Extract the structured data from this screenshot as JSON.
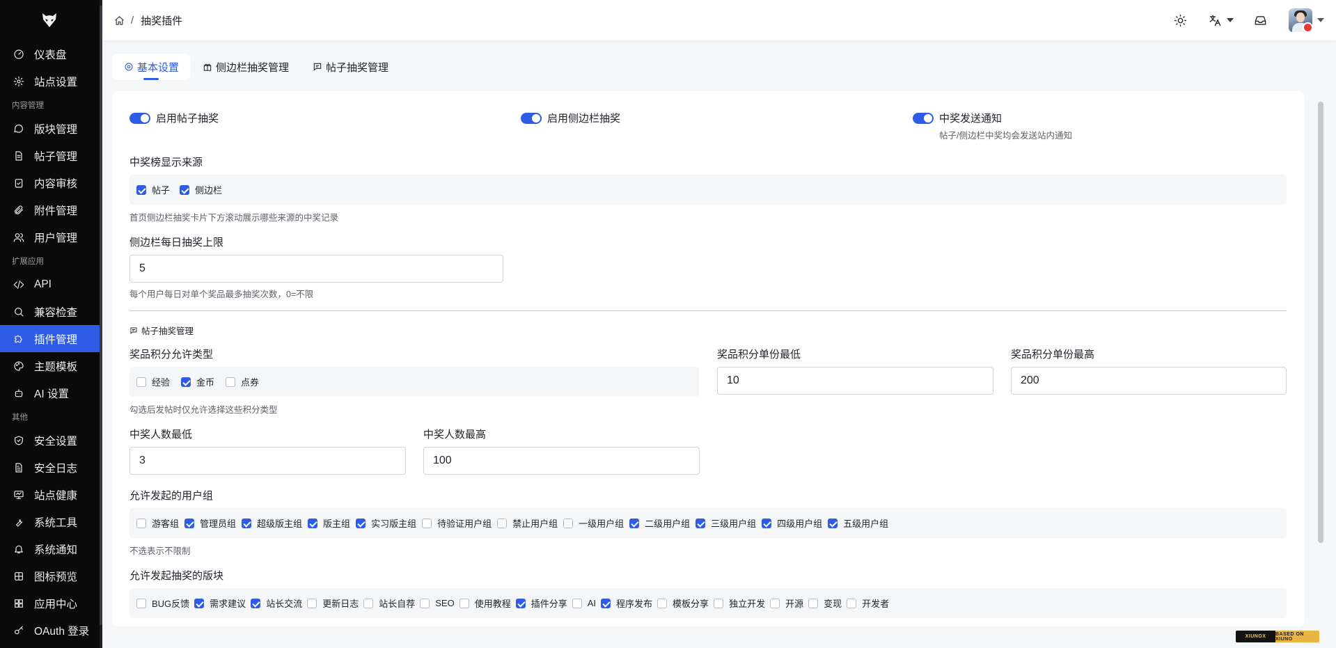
{
  "sidebar": {
    "items": [
      {
        "type": "item",
        "label": "仪表盘",
        "icon": "dashboard-icon"
      },
      {
        "type": "item",
        "label": "站点设置",
        "icon": "gear-icon"
      },
      {
        "type": "section",
        "label": "内容管理"
      },
      {
        "type": "item",
        "label": "版块管理",
        "icon": "chat-bubble-icon"
      },
      {
        "type": "item",
        "label": "帖子管理",
        "icon": "document-icon"
      },
      {
        "type": "item",
        "label": "内容审核",
        "icon": "clipboard-check-icon"
      },
      {
        "type": "item",
        "label": "附件管理",
        "icon": "paperclip-icon"
      },
      {
        "type": "item",
        "label": "用户管理",
        "icon": "users-icon"
      },
      {
        "type": "section",
        "label": "扩展应用"
      },
      {
        "type": "item",
        "label": "API",
        "icon": "code-icon"
      },
      {
        "type": "item",
        "label": "兼容检查",
        "icon": "search-icon"
      },
      {
        "type": "item",
        "label": "插件管理",
        "icon": "puzzle-icon",
        "active": true
      },
      {
        "type": "item",
        "label": "主题模板",
        "icon": "palette-icon"
      },
      {
        "type": "item",
        "label": "AI 设置",
        "icon": "robot-icon"
      },
      {
        "type": "section",
        "label": "其他"
      },
      {
        "type": "item",
        "label": "安全设置",
        "icon": "shield-icon"
      },
      {
        "type": "item",
        "label": "安全日志",
        "icon": "log-icon"
      },
      {
        "type": "item",
        "label": "站点健康",
        "icon": "monitor-icon"
      },
      {
        "type": "item",
        "label": "系统工具",
        "icon": "wrench-icon"
      },
      {
        "type": "item",
        "label": "系统通知",
        "icon": "bell-icon"
      },
      {
        "type": "item",
        "label": "图标预览",
        "icon": "grid-icon"
      },
      {
        "type": "item",
        "label": "应用中心",
        "icon": "apps-icon"
      },
      {
        "type": "item",
        "label": "OAuth 登录",
        "icon": "key-icon"
      }
    ]
  },
  "header": {
    "breadcrumb_sep": "/",
    "breadcrumb_current": "抽奖插件",
    "icons": [
      "home-icon",
      "sun-icon",
      "translate-icon",
      "inbox-icon",
      "avatar"
    ]
  },
  "tabs": [
    {
      "label": "基本设置",
      "icon": "gear-icon",
      "active": true
    },
    {
      "label": "侧边栏抽奖管理",
      "icon": "gift-icon"
    },
    {
      "label": "帖子抽奖管理",
      "icon": "chat-square-icon"
    }
  ],
  "form": {
    "toggles": [
      {
        "label": "启用帖子抽奖",
        "on": true
      },
      {
        "label": "启用侧边栏抽奖",
        "on": true
      },
      {
        "label": "中奖发送通知",
        "on": true,
        "hint": "帖子/侧边栏中奖均会发送站内通知"
      }
    ],
    "winners_source": {
      "label": "中奖榜显示来源",
      "options": [
        {
          "label": "帖子",
          "checked": true
        },
        {
          "label": "侧边栏",
          "checked": true
        }
      ],
      "hint": "首页侧边栏抽奖卡片下方滚动展示哪些来源的中奖记录"
    },
    "sidebar_daily_limit": {
      "label": "侧边栏每日抽奖上限",
      "value": "5",
      "hint": "每个用户每日对单个奖品最多抽奖次数，0=不限"
    },
    "post_section_title": "帖子抽奖管理",
    "points_types": {
      "label": "奖品积分允许类型",
      "options": [
        {
          "label": "经验",
          "checked": false
        },
        {
          "label": "金币",
          "checked": true
        },
        {
          "label": "点券",
          "checked": false
        }
      ],
      "hint": "勾选后发帖时仅允许选择这些积分类型"
    },
    "points_min": {
      "label": "奖品积分单份最低",
      "value": "10"
    },
    "points_max": {
      "label": "奖品积分单份最高",
      "value": "200"
    },
    "winners_min": {
      "label": "中奖人数最低",
      "value": "3"
    },
    "winners_max": {
      "label": "中奖人数最高",
      "value": "100"
    },
    "user_groups": {
      "label": "允许发起的用户组",
      "options": [
        {
          "label": "游客组",
          "checked": false
        },
        {
          "label": "管理员组",
          "checked": true
        },
        {
          "label": "超级版主组",
          "checked": true
        },
        {
          "label": "版主组",
          "checked": true
        },
        {
          "label": "实习版主组",
          "checked": true
        },
        {
          "label": "待验证用户组",
          "checked": false
        },
        {
          "label": "禁止用户组",
          "checked": false
        },
        {
          "label": "一级用户组",
          "checked": false
        },
        {
          "label": "二级用户组",
          "checked": true
        },
        {
          "label": "三级用户组",
          "checked": true
        },
        {
          "label": "四级用户组",
          "checked": true
        },
        {
          "label": "五级用户组",
          "checked": true
        }
      ],
      "hint": "不选表示不限制"
    },
    "forums": {
      "label": "允许发起抽奖的版块",
      "options": [
        {
          "label": "BUG反馈",
          "checked": false
        },
        {
          "label": "需求建议",
          "checked": true
        },
        {
          "label": "站长交流",
          "checked": true
        },
        {
          "label": "更新日志",
          "checked": false
        },
        {
          "label": "站长自荐",
          "checked": false
        },
        {
          "label": "SEO",
          "checked": false
        },
        {
          "label": "使用教程",
          "checked": false
        },
        {
          "label": "插件分享",
          "checked": true
        },
        {
          "label": "AI",
          "checked": false
        },
        {
          "label": "程序发布",
          "checked": true
        },
        {
          "label": "模板分享",
          "checked": false
        },
        {
          "label": "独立开发",
          "checked": false
        },
        {
          "label": "开源",
          "checked": false
        },
        {
          "label": "变现",
          "checked": false
        },
        {
          "label": "开发者",
          "checked": false
        }
      ]
    }
  },
  "footer_badge": {
    "left": "XIUNOX",
    "right": "BASED ON XIUNO"
  },
  "colors": {
    "accent": "#2f5ce6",
    "sidebar_bg": "#0a0a0b",
    "page_bg": "#f5f6f8"
  }
}
